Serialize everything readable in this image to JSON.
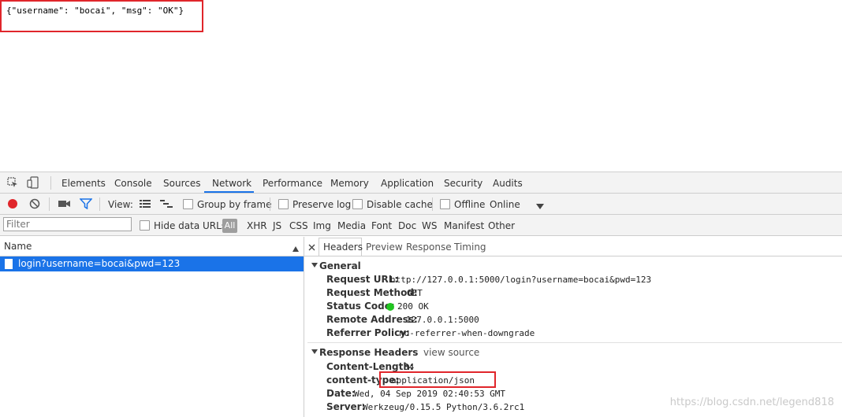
{
  "page": {
    "json_text": "{\"username\": \"bocai\", \"msg\": \"OK\"}"
  },
  "devtools": {
    "tabs": [
      "Elements",
      "Console",
      "Sources",
      "Network",
      "Performance",
      "Memory",
      "Application",
      "Security",
      "Audits"
    ],
    "active_tab": "Network",
    "toolbar": {
      "view_label": "View:",
      "group_by_frame": "Group by frame",
      "preserve_log": "Preserve log",
      "disable_cache": "Disable cache",
      "offline": "Offline",
      "throttling": "Online"
    },
    "filterbar": {
      "placeholder": "Filter",
      "hide_data_urls": "Hide data URLs",
      "types": [
        "All",
        "XHR",
        "JS",
        "CSS",
        "Img",
        "Media",
        "Font",
        "Doc",
        "WS",
        "Manifest",
        "Other"
      ]
    },
    "list": {
      "header": "Name",
      "rows": [
        "login?username=bocai&pwd=123"
      ]
    },
    "detail": {
      "subtabs": [
        "Headers",
        "Preview",
        "Response",
        "Timing"
      ],
      "active_subtab": "Headers",
      "general": {
        "title": "General",
        "request_url_key": "Request URL:",
        "request_url": "http://127.0.0.1:5000/login?username=bocai&pwd=123",
        "request_method_key": "Request Method:",
        "request_method": "GET",
        "status_code_key": "Status Code:",
        "status_code": "200 OK",
        "remote_address_key": "Remote Address:",
        "remote_address": "127.0.0.1:5000",
        "referrer_policy_key": "Referrer Policy:",
        "referrer_policy": "no-referrer-when-downgrade"
      },
      "response_headers": {
        "title": "Response Headers",
        "view_source": "view source",
        "content_length_key": "Content-Length:",
        "content_length": "34",
        "content_type_key": "content-type:",
        "content_type": "application/json",
        "date_key": "Date:",
        "date": "Wed, 04 Sep 2019 02:40:53 GMT",
        "server_key": "Server:",
        "server": "Werkzeug/0.15.5 Python/3.6.2rc1"
      }
    }
  },
  "watermark": "https://blog.csdn.net/legend818",
  "colors": {
    "accent": "#1a73e8",
    "highlight_box": "#e0262b",
    "status_ok": "#21c521",
    "record": "#e0262b"
  }
}
